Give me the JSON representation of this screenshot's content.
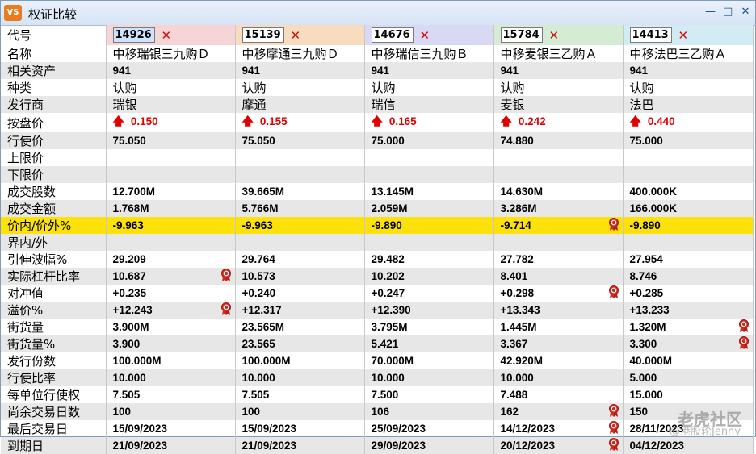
{
  "window": {
    "icon": "VS",
    "title": "权证比较",
    "controls": [
      "✕",
      "□",
      "✕"
    ]
  },
  "labels": {
    "code": "代号",
    "name": "名称",
    "underlying": "相关资产",
    "type": "种类",
    "issuer": "发行商",
    "bid": "按盘价",
    "strike": "行使价",
    "upper": "上限价",
    "lower": "下限价",
    "volume": "成交股数",
    "turnover": "成交金额",
    "moneyness": "价内/价外%",
    "inout": "界内/外",
    "iv": "引伸波幅%",
    "gearing": "实际杠杆比率",
    "delta": "对冲值",
    "premium": "溢价%",
    "outstanding": "街货量",
    "outstanding_pct": "街货量%",
    "issued": "发行份数",
    "ratio": "行使比率",
    "per_unit": "每单位行使权",
    "days": "尚余交易日数",
    "last_trade": "最后交易日",
    "expiry": "到期日"
  },
  "warrants": [
    {
      "code": "14926",
      "name": "中移瑞银三九购Ｄ",
      "underlying": "941",
      "type": "认购",
      "issuer": "瑞银",
      "bid": "0.150",
      "strike": "75.050",
      "upper": "",
      "lower": "",
      "volume": "12.700M",
      "turnover": "1.768M",
      "moneyness": "-9.963",
      "inout": "",
      "iv": "29.209",
      "gearing": "10.687",
      "delta": "+0.235",
      "premium": "+12.243",
      "outstanding": "3.900M",
      "outstanding_pct": "3.900",
      "issued": "100.000M",
      "ratio": "10.000",
      "per_unit": "7.505",
      "days": "100",
      "last_trade": "15/09/2023",
      "expiry": "21/09/2023"
    },
    {
      "code": "15139",
      "name": "中移摩通三九购Ｄ",
      "underlying": "941",
      "type": "认购",
      "issuer": "摩通",
      "bid": "0.155",
      "strike": "75.050",
      "upper": "",
      "lower": "",
      "volume": "39.665M",
      "turnover": "5.766M",
      "moneyness": "-9.963",
      "inout": "",
      "iv": "29.764",
      "gearing": "10.573",
      "delta": "+0.240",
      "premium": "+12.317",
      "outstanding": "23.565M",
      "outstanding_pct": "23.565",
      "issued": "100.000M",
      "ratio": "10.000",
      "per_unit": "7.505",
      "days": "100",
      "last_trade": "15/09/2023",
      "expiry": "21/09/2023"
    },
    {
      "code": "14676",
      "name": "中移瑞信三九购Ｂ",
      "underlying": "941",
      "type": "认购",
      "issuer": "瑞信",
      "bid": "0.165",
      "strike": "75.000",
      "upper": "",
      "lower": "",
      "volume": "13.145M",
      "turnover": "2.059M",
      "moneyness": "-9.890",
      "inout": "",
      "iv": "29.482",
      "gearing": "10.202",
      "delta": "+0.247",
      "premium": "+12.390",
      "outstanding": "3.795M",
      "outstanding_pct": "5.421",
      "issued": "70.000M",
      "ratio": "10.000",
      "per_unit": "7.500",
      "days": "106",
      "last_trade": "25/09/2023",
      "expiry": "29/09/2023"
    },
    {
      "code": "15784",
      "name": "中移麦银三乙购Ａ",
      "underlying": "941",
      "type": "认购",
      "issuer": "麦银",
      "bid": "0.242",
      "strike": "74.880",
      "upper": "",
      "lower": "",
      "volume": "14.630M",
      "turnover": "3.286M",
      "moneyness": "-9.714",
      "inout": "",
      "iv": "27.782",
      "gearing": "8.401",
      "delta": "+0.298",
      "premium": "+13.343",
      "outstanding": "1.445M",
      "outstanding_pct": "3.367",
      "issued": "42.920M",
      "ratio": "10.000",
      "per_unit": "7.488",
      "days": "162",
      "last_trade": "14/12/2023",
      "expiry": "20/12/2023"
    },
    {
      "code": "14413",
      "name": "中移法巴三乙购Ａ",
      "underlying": "941",
      "type": "认购",
      "issuer": "法巴",
      "bid": "0.440",
      "strike": "75.000",
      "upper": "",
      "lower": "",
      "volume": "400.000K",
      "turnover": "166.000K",
      "moneyness": "-9.890",
      "inout": "",
      "iv": "27.954",
      "gearing": "8.746",
      "delta": "+0.285",
      "premium": "+13.233",
      "outstanding": "1.320M",
      "outstanding_pct": "3.300",
      "issued": "40.000M",
      "ratio": "5.000",
      "per_unit": "15.000",
      "days": "150",
      "last_trade": "28/11/2023",
      "expiry": "04/12/2023"
    }
  ],
  "watermark": {
    "brand": "老虎社区",
    "handle": "@港股轮Jenny"
  },
  "colors": {
    "highlight_row": "#fde10a",
    "up": "#e00000",
    "badge": "#d02a1e"
  }
}
